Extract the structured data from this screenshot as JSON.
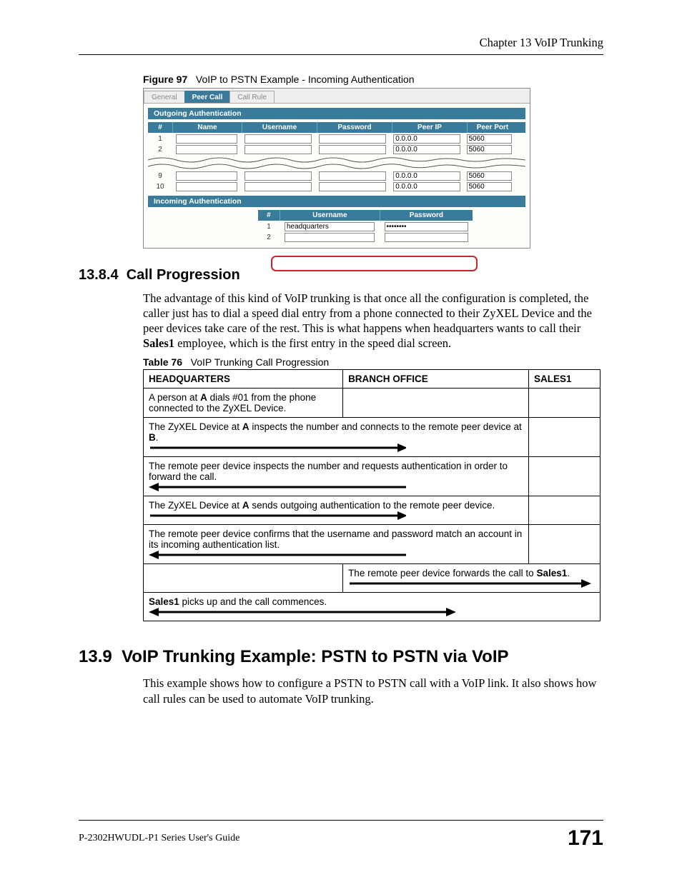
{
  "header": {
    "chapter": "Chapter 13 VoIP Trunking"
  },
  "figure": {
    "label": "Figure 97",
    "title": "VoIP to PSTN Example - Incoming Authentication",
    "tabs": [
      "General",
      "Peer Call",
      "Call Rule"
    ],
    "active_tab_index": 1,
    "outgoing_section": "Outgoing Authentication",
    "outgoing_headers": [
      "#",
      "Name",
      "Username",
      "Password",
      "Peer IP",
      "Peer Port"
    ],
    "outgoing_rows": [
      {
        "i": "1",
        "name": "",
        "user": "",
        "pass": "",
        "ip": "0.0.0.0",
        "port": "5060"
      },
      {
        "i": "2",
        "name": "",
        "user": "",
        "pass": "",
        "ip": "0.0.0.0",
        "port": "5060"
      },
      {
        "i": "torn_upper",
        "ip": "0.0.0.0",
        "port": "5060"
      },
      {
        "i": "9",
        "name": "",
        "user": "",
        "pass": "",
        "ip": "0.0.0.0",
        "port": "5060",
        "torn_lower": true
      },
      {
        "i": "10",
        "name": "",
        "user": "",
        "pass": "",
        "ip": "0.0.0.0",
        "port": "5060"
      }
    ],
    "incoming_section": "Incoming Authentication",
    "incoming_headers": [
      "#",
      "Username",
      "Password"
    ],
    "incoming_rows": [
      {
        "i": "1",
        "user": "headquarters",
        "pass": "••••••••"
      },
      {
        "i": "2",
        "user": "",
        "pass": ""
      }
    ]
  },
  "section_1384": {
    "number": "13.8.4",
    "title": "Call Progression",
    "para": "The advantage of this kind of VoIP trunking is that once all the configuration is completed, the caller just has to dial a speed dial entry from a phone connected to their ZyXEL Device and the peer devices take care of the rest. This is what happens when headquarters wants to call their Sales1 employee, which is the first entry in the speed dial screen.",
    "table_label": "Table 76",
    "table_title": "VoIP Trunking Call Progression",
    "columns": [
      "HEADQUARTERS",
      "BRANCH OFFICE",
      "SALES1"
    ],
    "rows": [
      {
        "hq": "A person at A dials #01 from the phone connected to the ZyXEL Device.",
        "bo": "",
        "s1": ""
      },
      {
        "span12_text": "The ZyXEL Device at A inspects the number and connects to the remote peer device at B.",
        "arrow": "right"
      },
      {
        "span12_text": "The remote peer device inspects the number and requests authentication in order to forward the call.",
        "arrow": "left"
      },
      {
        "span12_text": "The ZyXEL Device at A sends outgoing authentication to the remote peer device.",
        "arrow": "right"
      },
      {
        "span12_text": "The remote peer device confirms that the username and password match an account in its incoming authentication list.",
        "arrow": "left"
      },
      {
        "hq_empty": true,
        "span23_text": "The remote peer device forwards the call to Sales1.",
        "arrow": "right"
      },
      {
        "span123_text": "Sales1 picks up and the call commences.",
        "arrow": "both"
      }
    ]
  },
  "section_139": {
    "number": "13.9",
    "title": "VoIP Trunking Example: PSTN to PSTN via VoIP",
    "para": "This example shows how to configure a PSTN to PSTN call with a VoIP link. It also shows how call rules can be used to automate VoIP trunking."
  },
  "footer": {
    "guide": "P-2302HWUDL-P1 Series User's Guide",
    "page": "171"
  }
}
